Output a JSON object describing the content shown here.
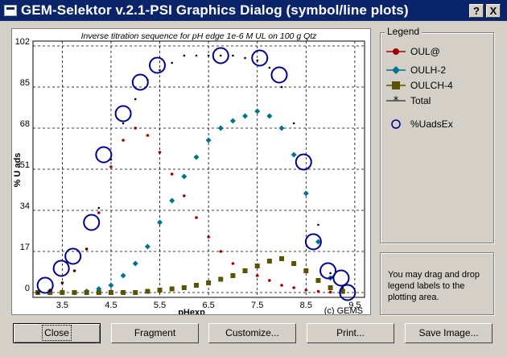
{
  "window": {
    "title": "GEM-Selektor v.2.1-PSI Graphics Dialog (symbol/line plots)",
    "help_label": "?",
    "close_label": "X"
  },
  "legend": {
    "title": "Legend",
    "items": [
      {
        "label": "OUL@",
        "color": "#a00000",
        "marker": "circle-line"
      },
      {
        "label": "OULH-2",
        "color": "#00748c",
        "marker": "diamond-line"
      },
      {
        "label": "OULCH-4",
        "color": "#5b5300",
        "marker": "square-line"
      },
      {
        "label": "Total",
        "color": "#000000",
        "marker": "star-line"
      },
      {
        "label": "%UadsEx",
        "color": "#00008b",
        "marker": "open-circle"
      }
    ]
  },
  "hint": {
    "text": "You may drag and drop legend labels to the plotting area."
  },
  "buttons": {
    "close": "Close",
    "fragment": "Fragment",
    "customize": "Customize...",
    "print": "Print...",
    "save": "Save Image..."
  },
  "chart_data": {
    "type": "scatter",
    "title": "Inverse titration sequence for pH edge 1e-6 M UL on 100 g Qtz",
    "xlabel": "pHexp",
    "ylabel": "% U ads",
    "xlim": [
      2.9,
      9.7
    ],
    "ylim": [
      -2,
      104
    ],
    "x_ticks": [
      3.5,
      4.5,
      5.5,
      6.5,
      7.5,
      8.5,
      9.5
    ],
    "y_ticks": [
      0,
      17,
      34,
      51,
      68,
      85,
      102
    ],
    "grid": true,
    "corner_note": "(c) GEMS",
    "series": [
      {
        "name": "OUL@",
        "color": "#a00000",
        "marker": "dot",
        "x": [
          3.0,
          3.25,
          3.5,
          3.75,
          4.0,
          4.25,
          4.5,
          4.75,
          5.0,
          5.25,
          5.5,
          5.75,
          6.0,
          6.25,
          6.5,
          6.75,
          7.0,
          7.25,
          7.5,
          7.75,
          8.0,
          8.25,
          8.5,
          8.75,
          9.0,
          9.25
        ],
        "y": [
          0,
          1,
          4,
          9,
          18,
          33,
          52,
          63,
          68,
          65,
          58,
          49,
          40,
          31,
          23,
          17,
          12,
          9,
          7,
          5,
          3,
          2,
          1,
          0.5,
          0.2,
          0
        ]
      },
      {
        "name": "OULH-2",
        "color": "#00748c",
        "marker": "diamond",
        "x": [
          3.0,
          3.25,
          3.5,
          3.75,
          4.0,
          4.25,
          4.5,
          4.75,
          5.0,
          5.25,
          5.5,
          5.75,
          6.0,
          6.25,
          6.5,
          6.75,
          7.0,
          7.25,
          7.5,
          7.75,
          8.0,
          8.25,
          8.5,
          8.75,
          9.0,
          9.25
        ],
        "y": [
          0,
          0,
          0,
          0,
          0.5,
          1.5,
          3,
          7,
          12,
          19,
          29,
          38,
          48,
          56,
          63,
          68,
          71,
          73,
          75,
          73,
          68,
          57,
          41,
          21,
          6,
          1
        ]
      },
      {
        "name": "OULCH-4",
        "color": "#5b5300",
        "marker": "square",
        "x": [
          3.0,
          3.25,
          3.5,
          3.75,
          4.0,
          4.25,
          4.5,
          4.75,
          5.0,
          5.25,
          5.5,
          5.75,
          6.0,
          6.25,
          6.5,
          6.75,
          7.0,
          7.25,
          7.5,
          7.75,
          8.0,
          8.25,
          8.5,
          8.75,
          9.0,
          9.25
        ],
        "y": [
          0,
          0,
          0,
          0,
          0,
          0,
          0,
          0,
          0,
          0.5,
          1,
          1.5,
          2,
          3,
          4,
          5.5,
          7,
          9,
          11,
          13,
          14,
          12,
          9,
          5,
          2,
          0.5
        ]
      },
      {
        "name": "Total",
        "color": "#000000",
        "marker": "star",
        "x": [
          3.0,
          3.25,
          3.5,
          3.75,
          4.0,
          4.25,
          4.5,
          4.75,
          5.0,
          5.25,
          5.5,
          5.75,
          6.0,
          6.25,
          6.5,
          6.75,
          7.0,
          7.25,
          7.5,
          7.75,
          8.0,
          8.25,
          8.5,
          8.75,
          9.0,
          9.25
        ],
        "y": [
          0,
          1,
          4,
          9,
          18,
          35,
          55,
          70,
          80,
          88,
          92,
          95,
          98,
          98,
          98,
          98,
          98,
          97,
          96,
          93,
          85,
          70,
          51,
          28,
          8,
          2
        ]
      },
      {
        "name": "%UadsEx",
        "color": "#00008b",
        "marker": "open-circle",
        "x": [
          3.15,
          3.48,
          3.72,
          4.1,
          4.35,
          4.75,
          5.1,
          5.45,
          6.75,
          7.55,
          7.95,
          8.45,
          8.65,
          8.95,
          9.22,
          9.35
        ],
        "y": [
          3,
          10,
          15,
          29,
          57,
          74,
          87,
          94,
          98,
          97,
          90,
          54,
          21,
          9,
          6,
          0
        ]
      }
    ]
  }
}
